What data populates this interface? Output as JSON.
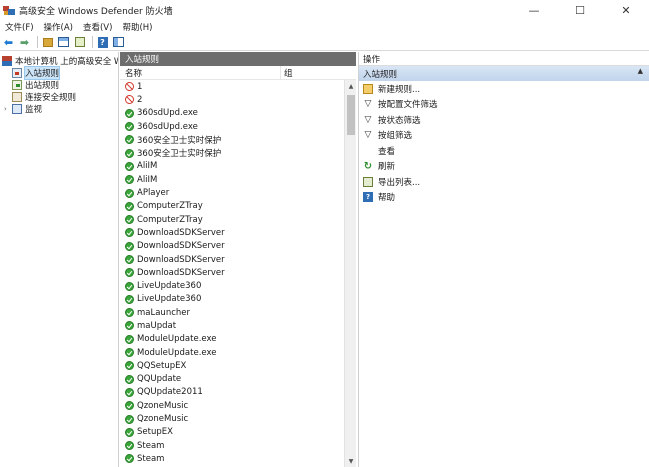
{
  "window": {
    "title": "高级安全 Windows Defender 防火墙",
    "minimize": "—",
    "maximize": "☐",
    "close": "✕"
  },
  "menu": [
    "文件(F)",
    "操作(A)",
    "查看(V)",
    "帮助(H)"
  ],
  "tree": {
    "root": "本地计算机 上的高级安全 Windows Defender 防火墙",
    "expander": "›",
    "items": [
      {
        "label": "入站规则",
        "icon": "inbound-rules-icon",
        "selected": true
      },
      {
        "label": "出站规则",
        "icon": "outbound-rules-icon",
        "selected": false
      },
      {
        "label": "连接安全规则",
        "icon": "connection-security-icon",
        "selected": false
      },
      {
        "label": "监视",
        "icon": "monitor-icon",
        "selected": false
      }
    ]
  },
  "middle": {
    "header": "入站规则",
    "columns": {
      "name": "名称",
      "group": "组"
    },
    "rules": [
      {
        "name": "1",
        "status": "block"
      },
      {
        "name": "2",
        "status": "block"
      },
      {
        "name": "360sdUpd.exe",
        "status": "allow"
      },
      {
        "name": "360sdUpd.exe",
        "status": "allow"
      },
      {
        "name": "360安全卫士实时保护",
        "status": "allow"
      },
      {
        "name": "360安全卫士实时保护",
        "status": "allow"
      },
      {
        "name": "AliIM",
        "status": "allow"
      },
      {
        "name": "AliIM",
        "status": "allow"
      },
      {
        "name": "APlayer",
        "status": "allow"
      },
      {
        "name": "ComputerZTray",
        "status": "allow"
      },
      {
        "name": "ComputerZTray",
        "status": "allow"
      },
      {
        "name": "DownloadSDKServer",
        "status": "allow"
      },
      {
        "name": "DownloadSDKServer",
        "status": "allow"
      },
      {
        "name": "DownloadSDKServer",
        "status": "allow"
      },
      {
        "name": "DownloadSDKServer",
        "status": "allow"
      },
      {
        "name": "LiveUpdate360",
        "status": "allow"
      },
      {
        "name": "LiveUpdate360",
        "status": "allow"
      },
      {
        "name": "maLauncher",
        "status": "allow"
      },
      {
        "name": "maUpdat",
        "status": "allow"
      },
      {
        "name": "ModuleUpdate.exe",
        "status": "allow"
      },
      {
        "name": "ModuleUpdate.exe",
        "status": "allow"
      },
      {
        "name": "QQSetupEX",
        "status": "allow"
      },
      {
        "name": "QQUpdate",
        "status": "allow"
      },
      {
        "name": "QQUpdate2011",
        "status": "allow"
      },
      {
        "name": "QzoneMusic",
        "status": "allow"
      },
      {
        "name": "QzoneMusic",
        "status": "allow"
      },
      {
        "name": "SetupEX",
        "status": "allow"
      },
      {
        "name": "Steam",
        "status": "allow"
      },
      {
        "name": "Steam",
        "status": "allow"
      }
    ]
  },
  "actions": {
    "header": "操作",
    "section": "入站规则",
    "section_arrow": "▲",
    "items": [
      {
        "label": "新建规则...",
        "icon": "new-rule-icon"
      },
      {
        "label": "按配置文件筛选",
        "icon": "filter-icon"
      },
      {
        "label": "按状态筛选",
        "icon": "filter-icon"
      },
      {
        "label": "按组筛选",
        "icon": "filter-icon"
      },
      {
        "label": "查看",
        "icon": "view-icon"
      },
      {
        "label": "刷新",
        "icon": "refresh-icon"
      },
      {
        "label": "导出列表...",
        "icon": "export-list-icon"
      },
      {
        "label": "帮助",
        "icon": "help-icon"
      }
    ]
  }
}
